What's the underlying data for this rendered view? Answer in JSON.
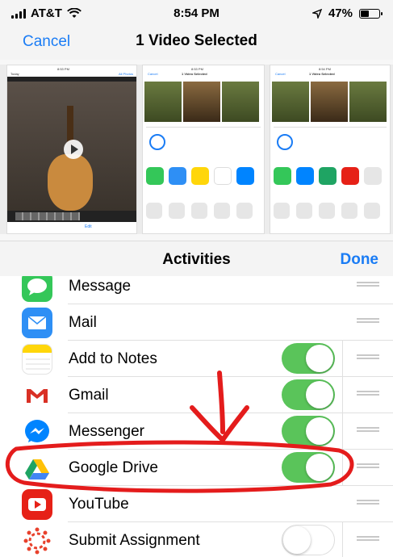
{
  "status_bar": {
    "carrier": "AT&T",
    "time": "8:54 PM",
    "battery": "47%",
    "battery_level": 0.47
  },
  "nav": {
    "cancel_label": "Cancel",
    "title": "1 Video Selected"
  },
  "thumbnails": {
    "first": {
      "time": "8:53 PM",
      "date": "Today",
      "all_photos": "All Photos",
      "edit": "Edit"
    },
    "second": {
      "time": "8:53 PM",
      "cancel": "Cancel",
      "title": "1 Video Selected"
    },
    "third": {
      "time": "8:54 PM",
      "cancel": "Cancel",
      "title": "1 Video Selected"
    }
  },
  "activities": {
    "title": "Activities",
    "done_label": "Done"
  },
  "list": [
    {
      "label": "Message",
      "icon": "message-icon",
      "toggle": null,
      "color": "#34c759"
    },
    {
      "label": "Mail",
      "icon": "mail-icon",
      "toggle": null,
      "color": "#2e8ff5"
    },
    {
      "label": "Add to Notes",
      "icon": "notes-icon",
      "toggle": true,
      "color": "#ffd60a"
    },
    {
      "label": "Gmail",
      "icon": "gmail-icon",
      "toggle": true,
      "color": "#d93025"
    },
    {
      "label": "Messenger",
      "icon": "messenger-icon",
      "toggle": true,
      "color": "#0084ff"
    },
    {
      "label": "Google Drive",
      "icon": "google-drive-icon",
      "toggle": true,
      "color": "#1fa463"
    },
    {
      "label": "YouTube",
      "icon": "youtube-icon",
      "toggle": null,
      "color": "#e62117"
    },
    {
      "label": "Submit Assignment",
      "icon": "submit-assignment-icon",
      "toggle": false,
      "color": "#e8412c"
    }
  ],
  "colors": {
    "accent": "#1a7cf5",
    "toggle_on": "#5ac45a",
    "annotation": "#e41c1c"
  }
}
